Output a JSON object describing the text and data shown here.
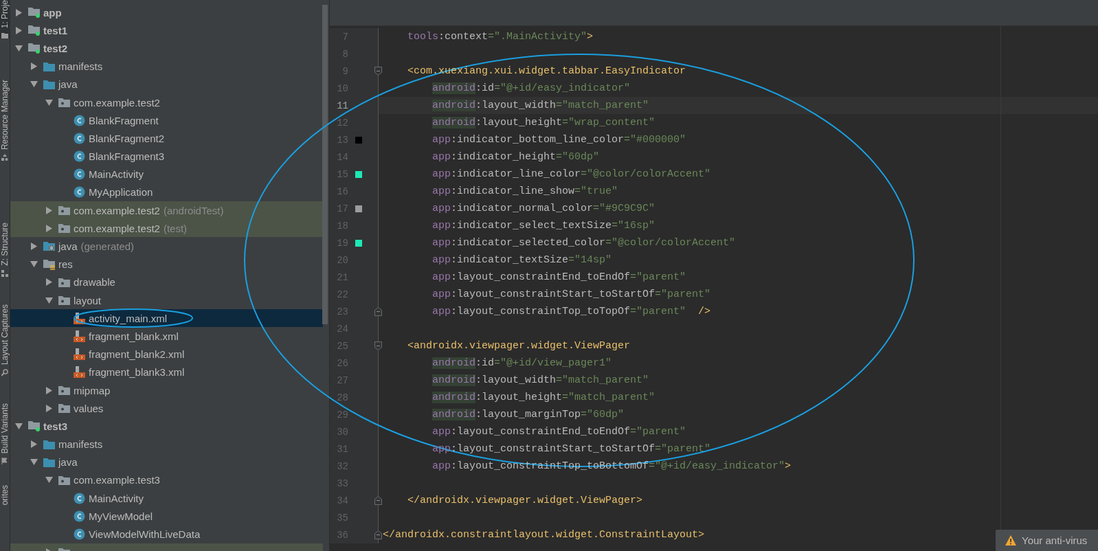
{
  "tool_strip": [
    {
      "label": "1: Proje",
      "selected": true
    },
    {
      "label": "Resource Manager",
      "selected": false
    },
    {
      "label": "Z: Structure",
      "selected": false
    },
    {
      "label": "Layout Captures",
      "selected": false
    },
    {
      "label": "Build Variants",
      "selected": false
    },
    {
      "label": "orites",
      "selected": false
    }
  ],
  "project_tree": [
    {
      "label": "app",
      "kind": "module",
      "expanded": false,
      "selected": false
    },
    {
      "label": "test1",
      "kind": "module",
      "expanded": false,
      "selected": false
    },
    {
      "label": "test2",
      "kind": "module",
      "expanded": true,
      "selected": false,
      "children": [
        {
          "label": "manifests",
          "kind": "source-folder",
          "expanded": false,
          "selected": false
        },
        {
          "label": "java",
          "kind": "source-folder",
          "expanded": true,
          "selected": false,
          "children": [
            {
              "label": "com.example.test2",
              "kind": "package",
              "expanded": true,
              "selected": false,
              "children": [
                {
                  "label": "BlankFragment",
                  "kind": "class",
                  "selected": false
                },
                {
                  "label": "BlankFragment2",
                  "kind": "class",
                  "selected": false
                },
                {
                  "label": "BlankFragment3",
                  "kind": "class",
                  "selected": false
                },
                {
                  "label": "MainActivity",
                  "kind": "class",
                  "selected": false
                },
                {
                  "label": "MyApplication",
                  "kind": "class",
                  "selected": false
                }
              ]
            },
            {
              "label": "com.example.test2",
              "note": "(androidTest)",
              "kind": "package",
              "expanded": false,
              "selected": false,
              "highlighted": true
            },
            {
              "label": "com.example.test2",
              "note": "(test)",
              "kind": "package",
              "expanded": false,
              "selected": false,
              "highlighted": true
            }
          ]
        },
        {
          "label": "java",
          "note": "(generated)",
          "kind": "generated-folder",
          "expanded": false,
          "selected": false
        },
        {
          "label": "res",
          "kind": "res-folder",
          "expanded": true,
          "selected": false,
          "children": [
            {
              "label": "drawable",
              "kind": "package",
              "expanded": false,
              "selected": false
            },
            {
              "label": "layout",
              "kind": "package",
              "expanded": true,
              "selected": false,
              "children": [
                {
                  "label": "activity_main.xml",
                  "kind": "layout-file",
                  "selected": true
                },
                {
                  "label": "fragment_blank.xml",
                  "kind": "layout-file",
                  "selected": false
                },
                {
                  "label": "fragment_blank2.xml",
                  "kind": "layout-file",
                  "selected": false
                },
                {
                  "label": "fragment_blank3.xml",
                  "kind": "layout-file",
                  "selected": false
                }
              ]
            },
            {
              "label": "mipmap",
              "kind": "package",
              "expanded": false,
              "selected": false
            },
            {
              "label": "values",
              "kind": "package",
              "expanded": false,
              "selected": false
            }
          ]
        }
      ]
    },
    {
      "label": "test3",
      "kind": "module",
      "expanded": true,
      "selected": false,
      "children": [
        {
          "label": "manifests",
          "kind": "source-folder",
          "expanded": false,
          "selected": false
        },
        {
          "label": "java",
          "kind": "source-folder",
          "expanded": true,
          "selected": false,
          "children": [
            {
              "label": "com.example.test3",
              "kind": "package",
              "expanded": true,
              "selected": false,
              "children": [
                {
                  "label": "MainActivity",
                  "kind": "class",
                  "selected": false
                },
                {
                  "label": "MyViewModel",
                  "kind": "class",
                  "selected": false
                },
                {
                  "label": "ViewModelWithLiveData",
                  "kind": "class",
                  "selected": false
                }
              ]
            },
            {
              "kind": "package",
              "expanded": false,
              "selected": false,
              "highlighted": true
            }
          ]
        }
      ]
    }
  ],
  "editor": {
    "lines": [
      {
        "number": "7",
        "current": false,
        "tokens": [
          {
            "kind": "ns",
            "text": "    tools"
          },
          {
            "kind": "attr",
            "text": ":context"
          },
          {
            "kind": "value",
            "text": "=\".MainActivity\""
          },
          {
            "kind": "tag",
            "text": ">"
          }
        ]
      },
      {
        "number": "8",
        "current": false
      },
      {
        "number": "9",
        "current": false,
        "kind": "fold-start",
        "tokens": [
          {
            "kind": "tag",
            "text": "    <com.xuexiang.xui.widget.tabbar.EasyIndicator"
          }
        ]
      },
      {
        "number": "10",
        "current": false,
        "tokens": [
          {
            "kind": "ns",
            "text": "        android",
            "highlighted": true
          },
          {
            "kind": "attr",
            "text": ":id"
          },
          {
            "kind": "value",
            "text": "=\"@+id/easy_indicator\""
          }
        ]
      },
      {
        "number": "11",
        "current": true,
        "tokens": [
          {
            "kind": "ns",
            "text": "        android",
            "highlighted": true
          },
          {
            "kind": "attr",
            "text": ":layout_width"
          },
          {
            "kind": "value",
            "text": "=\"match_parent\""
          }
        ]
      },
      {
        "number": "12",
        "current": false,
        "tokens": [
          {
            "kind": "ns",
            "text": "        android",
            "highlighted": true
          },
          {
            "kind": "attr",
            "text": ":layout_height"
          },
          {
            "kind": "value",
            "text": "=\"wrap_content\""
          }
        ]
      },
      {
        "number": "13",
        "current": false,
        "color": "#000000",
        "tokens": [
          {
            "kind": "ns",
            "text": "        app"
          },
          {
            "kind": "attr",
            "text": ":indicator_bottom_line_color"
          },
          {
            "kind": "value",
            "text": "=\"#000000\""
          }
        ]
      },
      {
        "number": "14",
        "current": false,
        "tokens": [
          {
            "kind": "ns",
            "text": "        app"
          },
          {
            "kind": "attr",
            "text": ":indicator_height"
          },
          {
            "kind": "value",
            "text": "=\"60dp\""
          }
        ]
      },
      {
        "number": "15",
        "current": false,
        "color": "#1de9b6",
        "tokens": [
          {
            "kind": "ns",
            "text": "        app"
          },
          {
            "kind": "attr",
            "text": ":indicator_line_color"
          },
          {
            "kind": "value",
            "text": "=\"@color/colorAccent\""
          }
        ]
      },
      {
        "number": "16",
        "current": false,
        "tokens": [
          {
            "kind": "ns",
            "text": "        app"
          },
          {
            "kind": "attr",
            "text": ":indicator_line_show"
          },
          {
            "kind": "value",
            "text": "=\"true\""
          }
        ]
      },
      {
        "number": "17",
        "current": false,
        "color": "#9c9c9c",
        "tokens": [
          {
            "kind": "ns",
            "text": "        app"
          },
          {
            "kind": "attr",
            "text": ":indicator_normal_color"
          },
          {
            "kind": "value",
            "text": "=\"#9C9C9C\""
          }
        ]
      },
      {
        "number": "18",
        "current": false,
        "tokens": [
          {
            "kind": "ns",
            "text": "        app"
          },
          {
            "kind": "attr",
            "text": ":indicator_select_textSize"
          },
          {
            "kind": "value",
            "text": "=\"16sp\""
          }
        ]
      },
      {
        "number": "19",
        "current": false,
        "color": "#1de9b6",
        "tokens": [
          {
            "kind": "ns",
            "text": "        app"
          },
          {
            "kind": "attr",
            "text": ":indicator_selected_color"
          },
          {
            "kind": "value",
            "text": "=\"@color/colorAccent\""
          }
        ]
      },
      {
        "number": "20",
        "current": false,
        "tokens": [
          {
            "kind": "ns",
            "text": "        app"
          },
          {
            "kind": "attr",
            "text": ":indicator_textSize"
          },
          {
            "kind": "value",
            "text": "=\"14sp\""
          }
        ]
      },
      {
        "number": "21",
        "current": false,
        "tokens": [
          {
            "kind": "ns",
            "text": "        app"
          },
          {
            "kind": "attr",
            "text": ":layout_constraintEnd_toEndOf"
          },
          {
            "kind": "value",
            "text": "=\"parent\""
          }
        ]
      },
      {
        "number": "22",
        "current": false,
        "tokens": [
          {
            "kind": "ns",
            "text": "        app"
          },
          {
            "kind": "attr",
            "text": ":layout_constraintStart_toStartOf"
          },
          {
            "kind": "value",
            "text": "=\"parent\""
          }
        ]
      },
      {
        "number": "23",
        "current": false,
        "kind": "fold-end",
        "tokens": [
          {
            "kind": "ns",
            "text": "        app"
          },
          {
            "kind": "attr",
            "text": ":layout_constraintTop_toTopOf"
          },
          {
            "kind": "value",
            "text": "=\"parent\""
          },
          {
            "kind": "tag",
            "text": "  />"
          }
        ]
      },
      {
        "number": "24",
        "current": false
      },
      {
        "number": "25",
        "current": false,
        "kind": "fold-start",
        "tokens": [
          {
            "kind": "tag",
            "text": "    <androidx.viewpager.widget.ViewPager"
          }
        ]
      },
      {
        "number": "26",
        "current": false,
        "tokens": [
          {
            "kind": "ns",
            "text": "        android",
            "highlighted": true
          },
          {
            "kind": "attr",
            "text": ":id"
          },
          {
            "kind": "value",
            "text": "=\"@+id/view_pager1\""
          }
        ]
      },
      {
        "number": "27",
        "current": false,
        "tokens": [
          {
            "kind": "ns",
            "text": "        android",
            "highlighted": true
          },
          {
            "kind": "attr",
            "text": ":layout_width"
          },
          {
            "kind": "value",
            "text": "=\"match_parent\""
          }
        ]
      },
      {
        "number": "28",
        "current": false,
        "tokens": [
          {
            "kind": "ns",
            "text": "        android",
            "highlighted": true
          },
          {
            "kind": "attr",
            "text": ":layout_height"
          },
          {
            "kind": "value",
            "text": "=\"match_parent\""
          }
        ]
      },
      {
        "number": "29",
        "current": false,
        "tokens": [
          {
            "kind": "ns",
            "text": "        android",
            "highlighted": true
          },
          {
            "kind": "attr",
            "text": ":layout_marginTop"
          },
          {
            "kind": "value",
            "text": "=\"60dp\""
          }
        ]
      },
      {
        "number": "30",
        "current": false,
        "tokens": [
          {
            "kind": "ns",
            "text": "        app"
          },
          {
            "kind": "attr",
            "text": ":layout_constraintEnd_toEndOf"
          },
          {
            "kind": "value",
            "text": "=\"parent\""
          }
        ]
      },
      {
        "number": "31",
        "current": false,
        "tokens": [
          {
            "kind": "ns",
            "text": "        app"
          },
          {
            "kind": "attr",
            "text": ":layout_constraintStart_toStartOf"
          },
          {
            "kind": "value",
            "text": "=\"parent\""
          }
        ]
      },
      {
        "number": "32",
        "current": false,
        "tokens": [
          {
            "kind": "ns",
            "text": "        app"
          },
          {
            "kind": "attr",
            "text": ":layout_constraintTop_toBottomOf"
          },
          {
            "kind": "value",
            "text": "=\"@+id/easy_indicator\""
          },
          {
            "kind": "tag",
            "text": ">"
          }
        ]
      },
      {
        "number": "33",
        "current": false
      },
      {
        "number": "34",
        "current": false,
        "kind": "fold-end",
        "tokens": [
          {
            "kind": "tag",
            "text": "    </androidx.viewpager.widget.ViewPager>"
          }
        ]
      },
      {
        "number": "35",
        "current": false
      },
      {
        "number": "36",
        "current": false,
        "kind": "fold-end",
        "tokens": [
          {
            "kind": "tag",
            "text": "</androidx.constraintlayout.widget.ConstraintLayout>"
          }
        ]
      }
    ]
  },
  "notification": {
    "text": "Your anti-virus"
  }
}
